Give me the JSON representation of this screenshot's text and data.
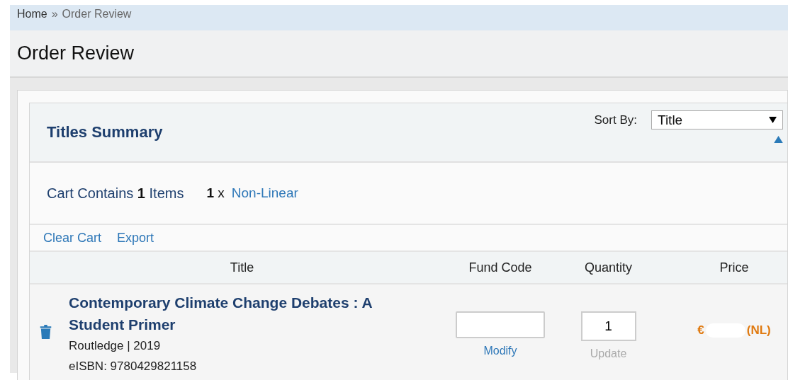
{
  "breadcrumb": [
    {
      "label": "Home",
      "current": false
    },
    {
      "label": "Order Review",
      "current": true
    }
  ],
  "breadcrumb_separator": "»",
  "page_title": "Order Review",
  "panel": {
    "title": "Titles Summary",
    "sort_label": "Sort By:",
    "sort_value": "Title",
    "sort_ascending": true
  },
  "cart_summary": {
    "prefix": "Cart Contains",
    "count": "1",
    "suffix": "Items",
    "groups": [
      {
        "count": "1",
        "times": "x",
        "name": "Non-Linear"
      }
    ]
  },
  "actions": [
    "Clear Cart",
    "Export"
  ],
  "table": {
    "columns": [
      "Title",
      "Fund Code",
      "Quantity",
      "Price"
    ],
    "rows": [
      {
        "title": "Contemporary Climate Change Debates : A Student Primer",
        "publisher": "Routledge | 2019",
        "isbn": "eISBN: 9780429821158",
        "fund_code": "",
        "fund_action": "Modify",
        "quantity": "1",
        "quantity_action": "Update",
        "quantity_action_disabled": true,
        "price_currency": "€",
        "price_redacted": true,
        "price_suffix": "(NL)"
      }
    ]
  }
}
